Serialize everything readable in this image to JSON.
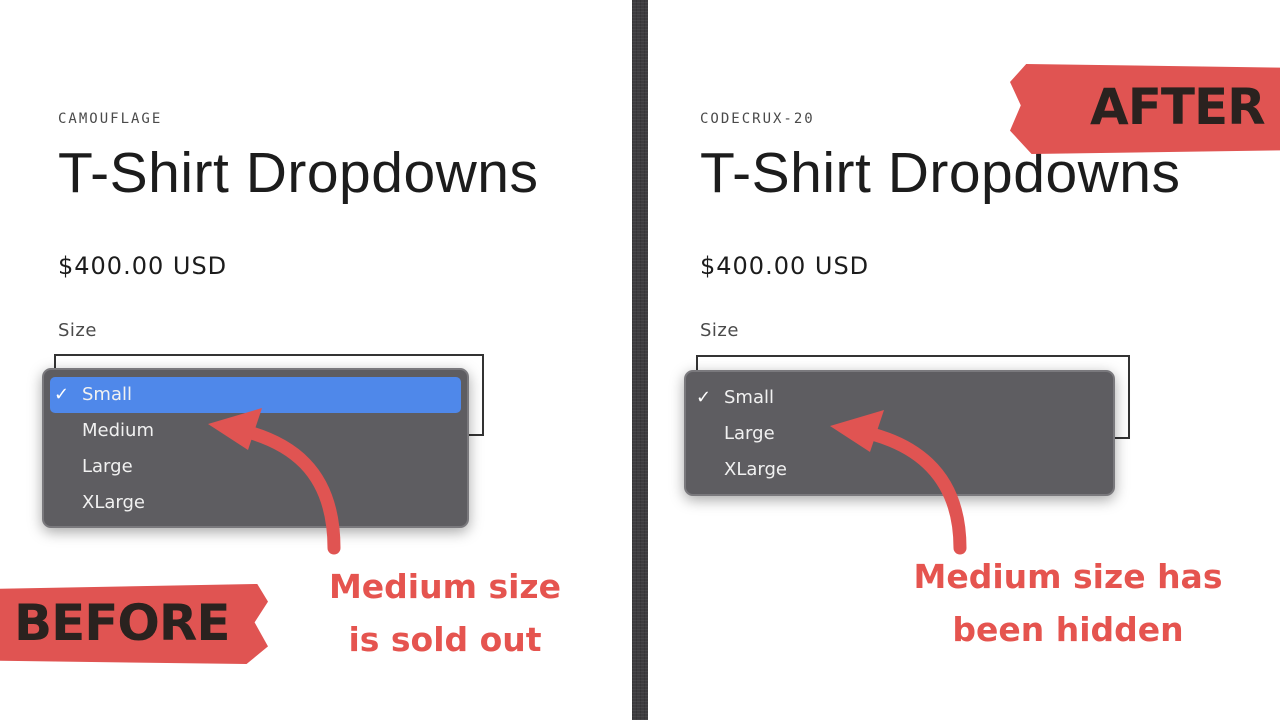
{
  "before": {
    "vendor": "CAMOUFLAGE",
    "title": "T-Shirt Dropdowns",
    "price": "$400.00 USD",
    "size_label": "Size",
    "options": [
      {
        "label": "Small",
        "selected": true
      },
      {
        "label": "Medium",
        "selected": false
      },
      {
        "label": "Large",
        "selected": false
      },
      {
        "label": "XLarge",
        "selected": false
      }
    ],
    "tag": "BEFORE",
    "note_line1": "Medium size",
    "note_line2": "is sold out"
  },
  "after": {
    "vendor": "CODECRUX-20",
    "title": "T-Shirt Dropdowns",
    "price": "$400.00 USD",
    "size_label": "Size",
    "options": [
      {
        "label": "Small",
        "selected": true
      },
      {
        "label": "Large",
        "selected": false
      },
      {
        "label": "XLarge",
        "selected": false
      }
    ],
    "tag": "AFTER",
    "note_line1": "Medium size has",
    "note_line2": "been hidden"
  },
  "checkmark": "✓",
  "colors": {
    "accent_red": "#e05452",
    "menu_bg": "#5e5d61",
    "selected_bg": "#4f88ea",
    "divider": "#3d3c3f"
  }
}
